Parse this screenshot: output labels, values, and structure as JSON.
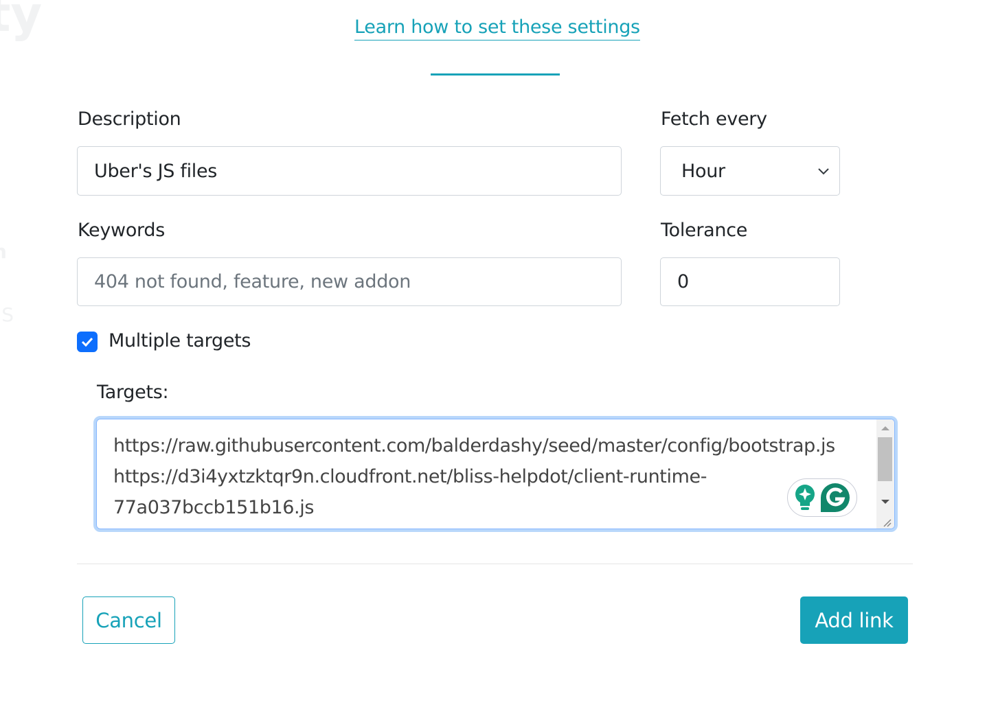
{
  "background": {
    "fragments": [
      "ty",
      "n",
      "JS"
    ]
  },
  "modal": {
    "learn_link": "Learn how to set these settings",
    "description": {
      "label": "Description",
      "value": "Uber's JS files"
    },
    "fetch_every": {
      "label": "Fetch every",
      "value": "Hour"
    },
    "keywords": {
      "label": "Keywords",
      "placeholder": "404 not found, feature, new addon"
    },
    "tolerance": {
      "label": "Tolerance",
      "value": "0"
    },
    "multiple_targets": {
      "label": "Multiple targets",
      "checked": true
    },
    "targets": {
      "label": "Targets:",
      "value": "https://raw.githubusercontent.com/balderdashy/seed/master/config/bootstrap.js\nhttps://d3i4yxtzktqr9n.cloudfront.net/bliss-helpdot/client-runtime-\n77a037bccb151b16.js"
    },
    "cancel_label": "Cancel",
    "add_label": "Add link",
    "colors": {
      "accent": "#17a2b8",
      "checkbox": "#0d6efd",
      "grammarly": "#11876b"
    }
  }
}
